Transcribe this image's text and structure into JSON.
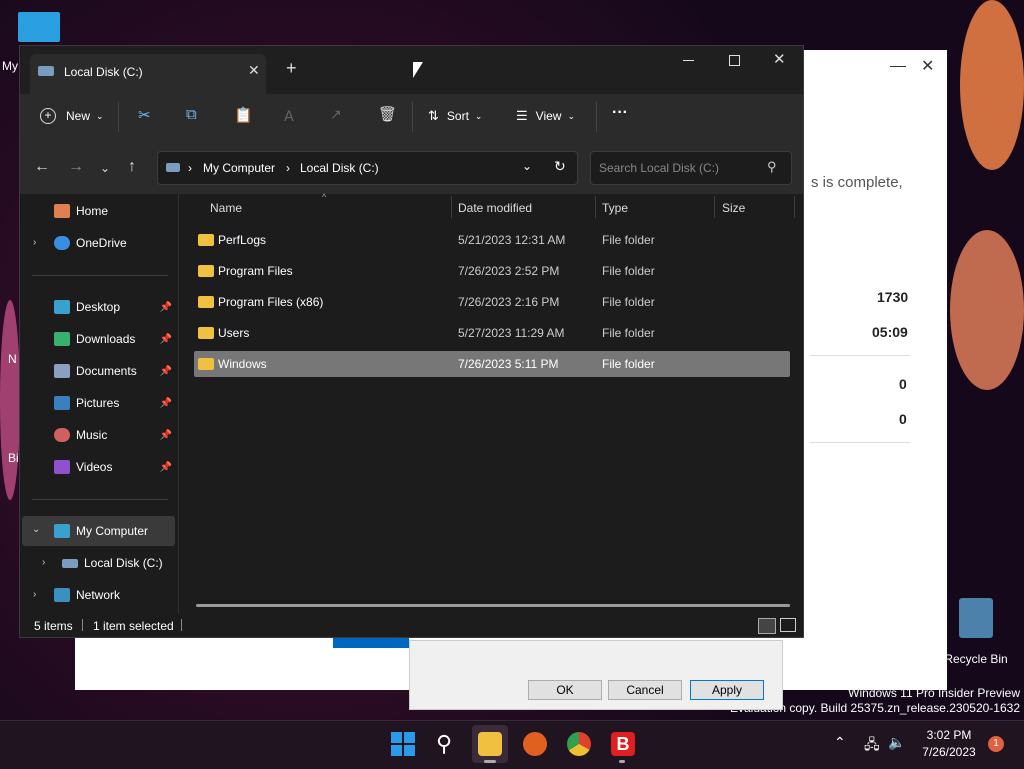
{
  "desktop": {
    "icon_label_partial": "My",
    "side_fragments": [
      "N",
      "Bi"
    ],
    "recycle_bin": "Recycle Bin",
    "watermark_line1": "Windows 11 Pro Insider Preview",
    "watermark_line2": "Evaluation copy. Build 25375.zn_release.230520-1632"
  },
  "background_window": {
    "fragment_text": "s is complete,",
    "values": [
      "1730",
      "05:09",
      "0",
      "0"
    ],
    "buttons": {
      "ok": "OK",
      "cancel": "Cancel",
      "apply": "Apply"
    }
  },
  "explorer": {
    "tab_title": "Local Disk (C:)",
    "new_tab": "+",
    "toolbar": {
      "new": "New",
      "sort": "Sort",
      "view": "View",
      "more": "···"
    },
    "breadcrumb": [
      "My Computer",
      "Local Disk (C:)"
    ],
    "search_placeholder": "Search Local Disk (C:)",
    "sidebar": {
      "home": "Home",
      "onedrive": "OneDrive",
      "desktop": "Desktop",
      "downloads": "Downloads",
      "documents": "Documents",
      "pictures": "Pictures",
      "music": "Music",
      "videos": "Videos",
      "my_computer": "My Computer",
      "local_disk": "Local Disk (C:)",
      "network": "Network"
    },
    "columns": {
      "name": "Name",
      "date": "Date modified",
      "type": "Type",
      "size": "Size"
    },
    "rows": [
      {
        "name": "PerfLogs",
        "date": "5/21/2023 12:31 AM",
        "type": "File folder"
      },
      {
        "name": "Program Files",
        "date": "7/26/2023 2:52 PM",
        "type": "File folder"
      },
      {
        "name": "Program Files (x86)",
        "date": "7/26/2023 2:16 PM",
        "type": "File folder"
      },
      {
        "name": "Users",
        "date": "5/27/2023 11:29 AM",
        "type": "File folder"
      },
      {
        "name": "Windows",
        "date": "7/26/2023 5:11 PM",
        "type": "File folder"
      }
    ],
    "status": {
      "items": "5 items",
      "selected": "1 item selected"
    }
  },
  "taskbar": {
    "time": "3:02 PM",
    "date": "7/26/2023",
    "notification_count": "1"
  },
  "colors": {
    "accent": "#0078d4",
    "folder": "#f0c040",
    "selected_row": "#777777"
  }
}
